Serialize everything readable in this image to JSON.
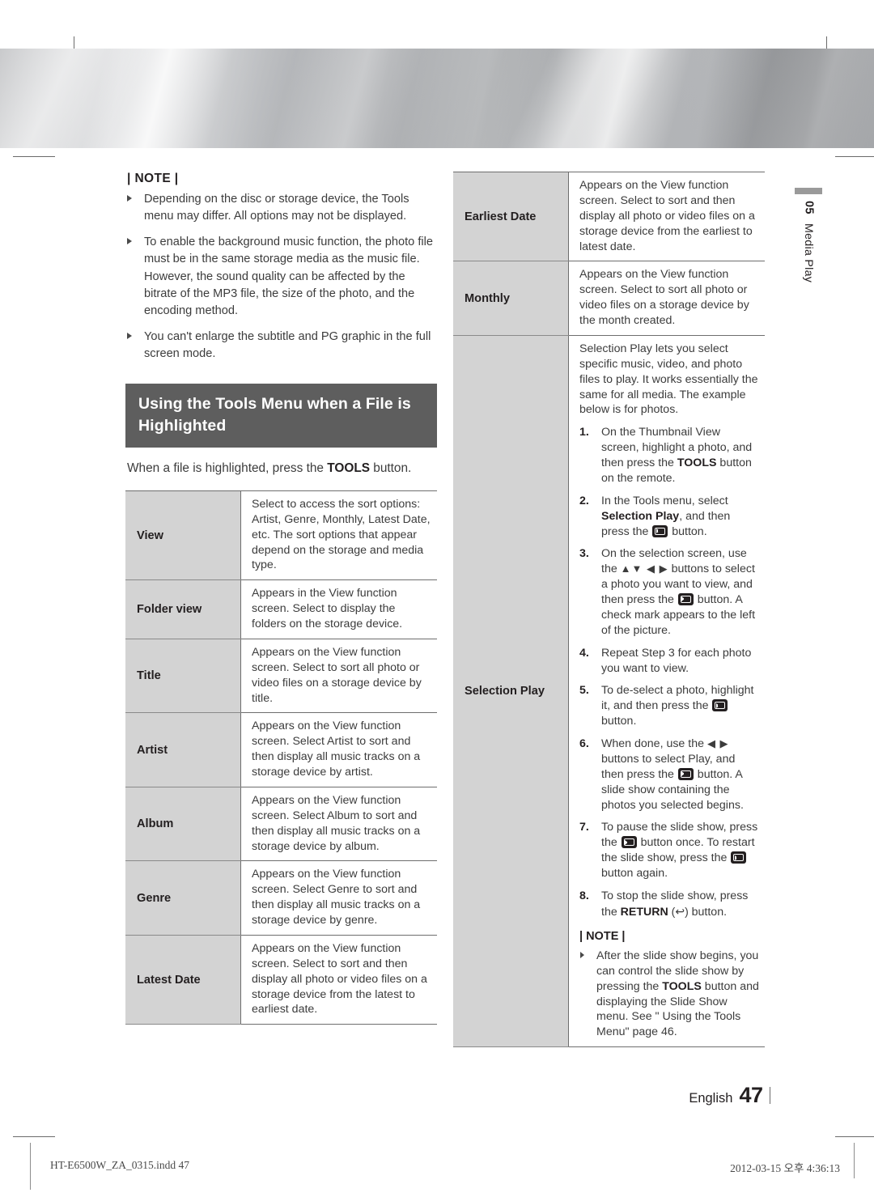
{
  "page": {
    "chapter_number": "05",
    "chapter_title": "Media Play",
    "language": "English",
    "page_number": "47",
    "print_file": "HT-E6500W_ZA_0315.indd  47",
    "print_timestamp": "2012-03-15  오후 4:36:13"
  },
  "left_note": {
    "title": "| NOTE |",
    "items": [
      "Depending on the disc or storage device, the Tools menu may differ. All options may not be displayed.",
      "To enable the background music function, the photo file must be in the same storage media as the music file. However, the sound quality can be affected by the bitrate of the MP3 file, the size of the photo, and the encoding method.",
      "You can't enlarge the subtitle and PG graphic in the full screen mode."
    ]
  },
  "section": {
    "heading": "Using the Tools Menu when a File is Highlighted",
    "intro_pre": "When a file is highlighted, press the ",
    "intro_bold": "TOOLS",
    "intro_post": " button."
  },
  "left_table": {
    "rows": [
      {
        "label": "View",
        "desc": "Select to access the sort options: Artist, Genre, Monthly, Latest Date, etc. The sort options that appear depend on the storage and media type."
      },
      {
        "label": "Folder view",
        "desc": "Appears in the View function screen. Select to display the folders on the storage device."
      },
      {
        "label": "Title",
        "desc": "Appears on the View function screen. Select to sort all photo or video files on a storage device by title."
      },
      {
        "label": "Artist",
        "desc": "Appears on the View function screen. Select Artist to sort and then display all music tracks on a storage device by artist."
      },
      {
        "label": "Album",
        "desc": "Appears on the View function screen. Select Album to sort and then display all music tracks on a storage device by album."
      },
      {
        "label": "Genre",
        "desc": "Appears on the View function screen. Select Genre to sort and then display all music tracks on a storage device by genre."
      },
      {
        "label": "Latest Date",
        "desc": "Appears on the View function screen. Select to sort and then display all photo or video files on a storage device from the latest to earliest date."
      }
    ]
  },
  "right_table": {
    "rows": [
      {
        "label": "Earliest Date",
        "desc": "Appears on the View function screen. Select to sort and then display all photo or video files on a storage device from the earliest to latest date."
      },
      {
        "label": "Monthly",
        "desc": "Appears on the View function screen. Select to sort all photo or video files on a storage device by the month created."
      }
    ],
    "selection_play": {
      "label": "Selection Play",
      "intro": "Selection Play lets you select specific music, video, and photo files to play. It works essentially the same for all media. The example below is for photos.",
      "steps": [
        {
          "num": "1.",
          "parts": [
            {
              "t": "text",
              "v": "On the Thumbnail View screen, highlight a photo, and then press the "
            },
            {
              "t": "bold",
              "v": "TOOLS"
            },
            {
              "t": "text",
              "v": " button on the remote."
            }
          ]
        },
        {
          "num": "2.",
          "parts": [
            {
              "t": "text",
              "v": "In the Tools menu, select "
            },
            {
              "t": "bold",
              "v": "Selection Play"
            },
            {
              "t": "text",
              "v": ", and then press the "
            },
            {
              "t": "enter",
              "v": ""
            },
            {
              "t": "text",
              "v": " button."
            }
          ]
        },
        {
          "num": "3.",
          "parts": [
            {
              "t": "text",
              "v": "On the selection screen, use the "
            },
            {
              "t": "arrows",
              "v": "▲▼ ◀ ▶"
            },
            {
              "t": "text",
              "v": " buttons to select a photo you want to view, and then press the "
            },
            {
              "t": "enter",
              "v": ""
            },
            {
              "t": "text",
              "v": " button. A check mark appears to the left of the picture."
            }
          ]
        },
        {
          "num": "4.",
          "parts": [
            {
              "t": "text",
              "v": "Repeat Step 3 for each photo you want to view."
            }
          ]
        },
        {
          "num": "5.",
          "parts": [
            {
              "t": "text",
              "v": "To de-select a photo, highlight it, and then press the "
            },
            {
              "t": "enter",
              "v": ""
            },
            {
              "t": "text",
              "v": " button."
            }
          ]
        },
        {
          "num": "6.",
          "parts": [
            {
              "t": "text",
              "v": "When done, use the "
            },
            {
              "t": "arrows",
              "v": "◀ ▶"
            },
            {
              "t": "text",
              "v": " buttons to select Play, and then press the "
            },
            {
              "t": "enter",
              "v": ""
            },
            {
              "t": "text",
              "v": " button. A slide show containing the photos you selected begins."
            }
          ]
        },
        {
          "num": "7.",
          "parts": [
            {
              "t": "text",
              "v": "To pause the slide show, press the "
            },
            {
              "t": "enter",
              "v": ""
            },
            {
              "t": "text",
              "v": " button once. To restart the slide show, press the "
            },
            {
              "t": "enter",
              "v": ""
            },
            {
              "t": "text",
              "v": " button again."
            }
          ]
        },
        {
          "num": "8.",
          "parts": [
            {
              "t": "text",
              "v": "To stop the slide show, press the "
            },
            {
              "t": "bold",
              "v": "RETURN"
            },
            {
              "t": "return",
              "v": " (↩) "
            },
            {
              "t": "text",
              "v": "button."
            }
          ]
        }
      ],
      "note_title": "| NOTE |",
      "note_parts": [
        {
          "t": "text",
          "v": "After the slide show begins, you can control the slide show by pressing the "
        },
        {
          "t": "bold",
          "v": "TOOLS"
        },
        {
          "t": "text",
          "v": " button and displaying the Slide Show menu. See \" Using the Tools Menu\" page 46."
        }
      ]
    }
  },
  "colors": {
    "heading_bar": "#5e5e5e",
    "table_label_bg": "#d3d3d3",
    "rule": "#6e6e6e",
    "text": "#3c3c3c"
  }
}
